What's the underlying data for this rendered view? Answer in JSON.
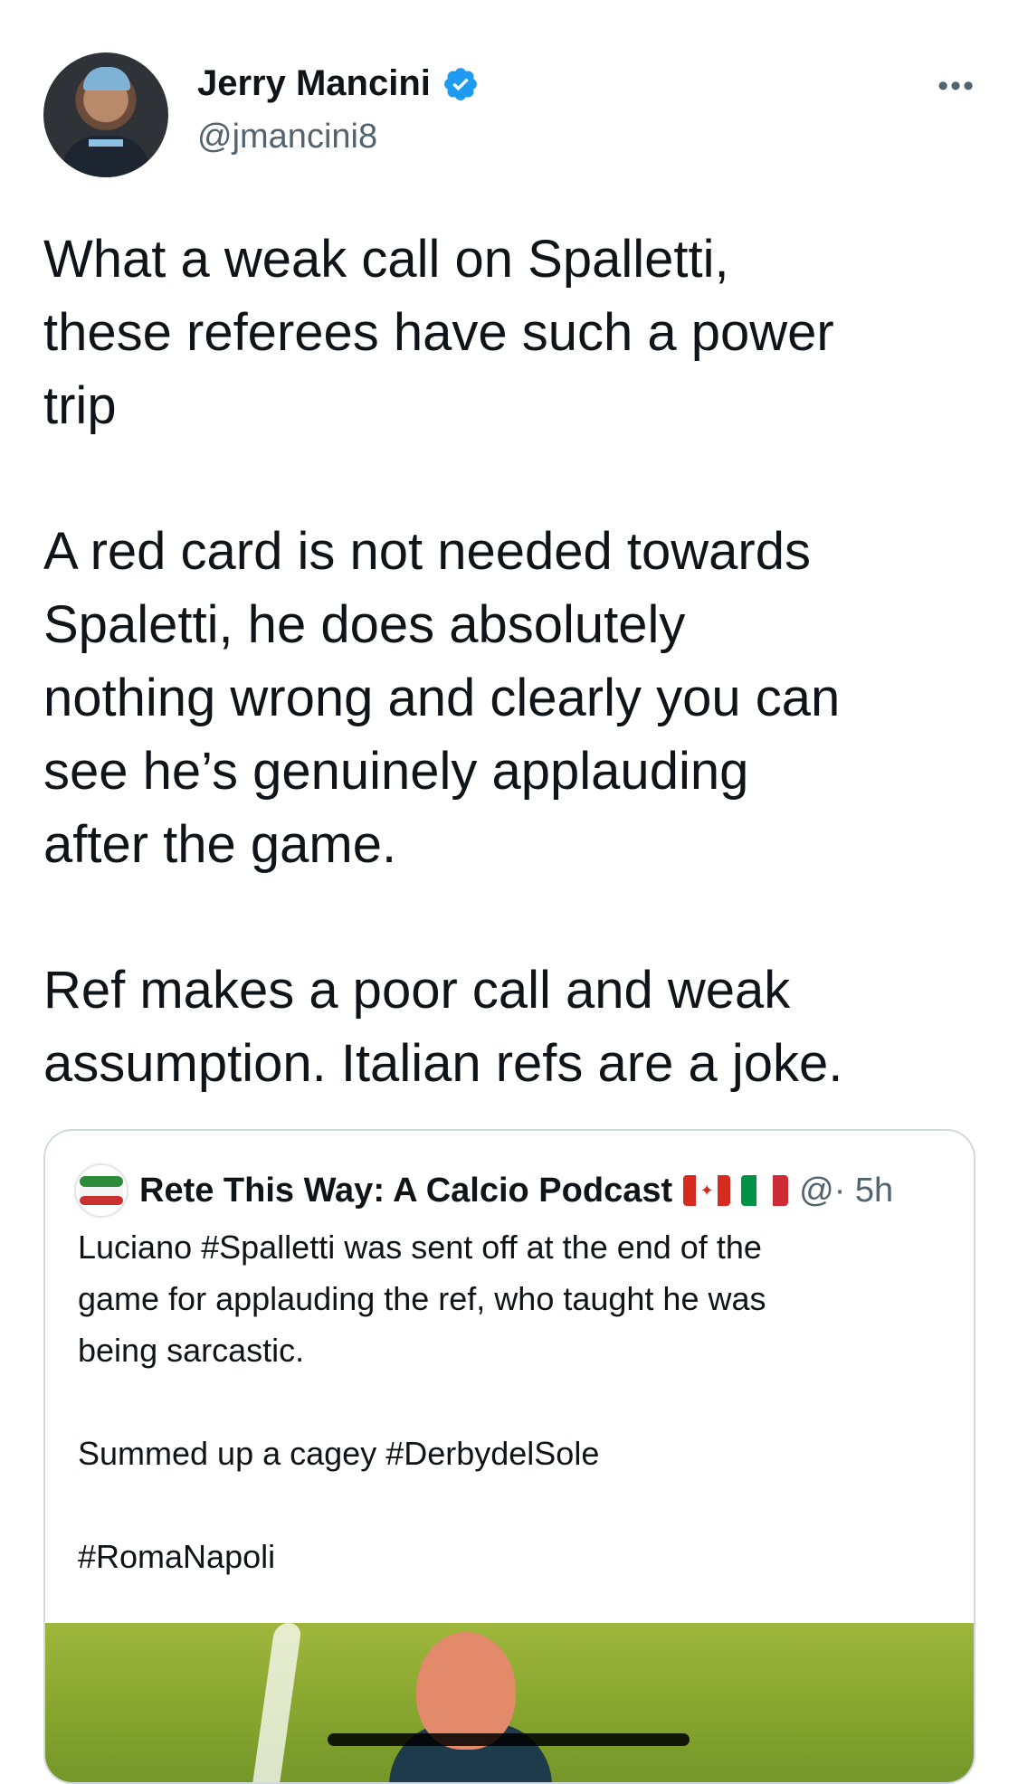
{
  "tweet": {
    "author_name": "Jerry Mancini",
    "handle": "@jmancini8",
    "more_menu": "•••",
    "paragraphs": [
      "What a weak call on Spalletti,\nthese referees have such a power\ntrip",
      "A red card is not needed towards\nSpaletti, he does absolutely\nnothing wrong and clearly you can\nsee he’s genuinely applauding\nafter the game.",
      "Ref makes a poor call and weak\nassumption. Italian refs are a joke."
    ]
  },
  "quoted_tweet": {
    "author_name": "Rete This Way: A Calcio Podcast",
    "meta": "@· 5h",
    "paragraphs": [
      "Luciano #Spalletti was sent off at the end of the\ngame for applauding the ref, who taught he was\nbeing sarcastic.",
      "Summed up a cagey #DerbydelSole",
      "#RomaNapoli"
    ]
  },
  "colors": {
    "verified_blue": "#1d9bf0",
    "secondary_text": "#536471",
    "border": "#cfd9de"
  },
  "icons": {
    "verified": "verified-badge-icon",
    "more": "more-options-icon",
    "flag_canada": "canada-flag-icon",
    "flag_italy": "italy-flag-icon"
  }
}
